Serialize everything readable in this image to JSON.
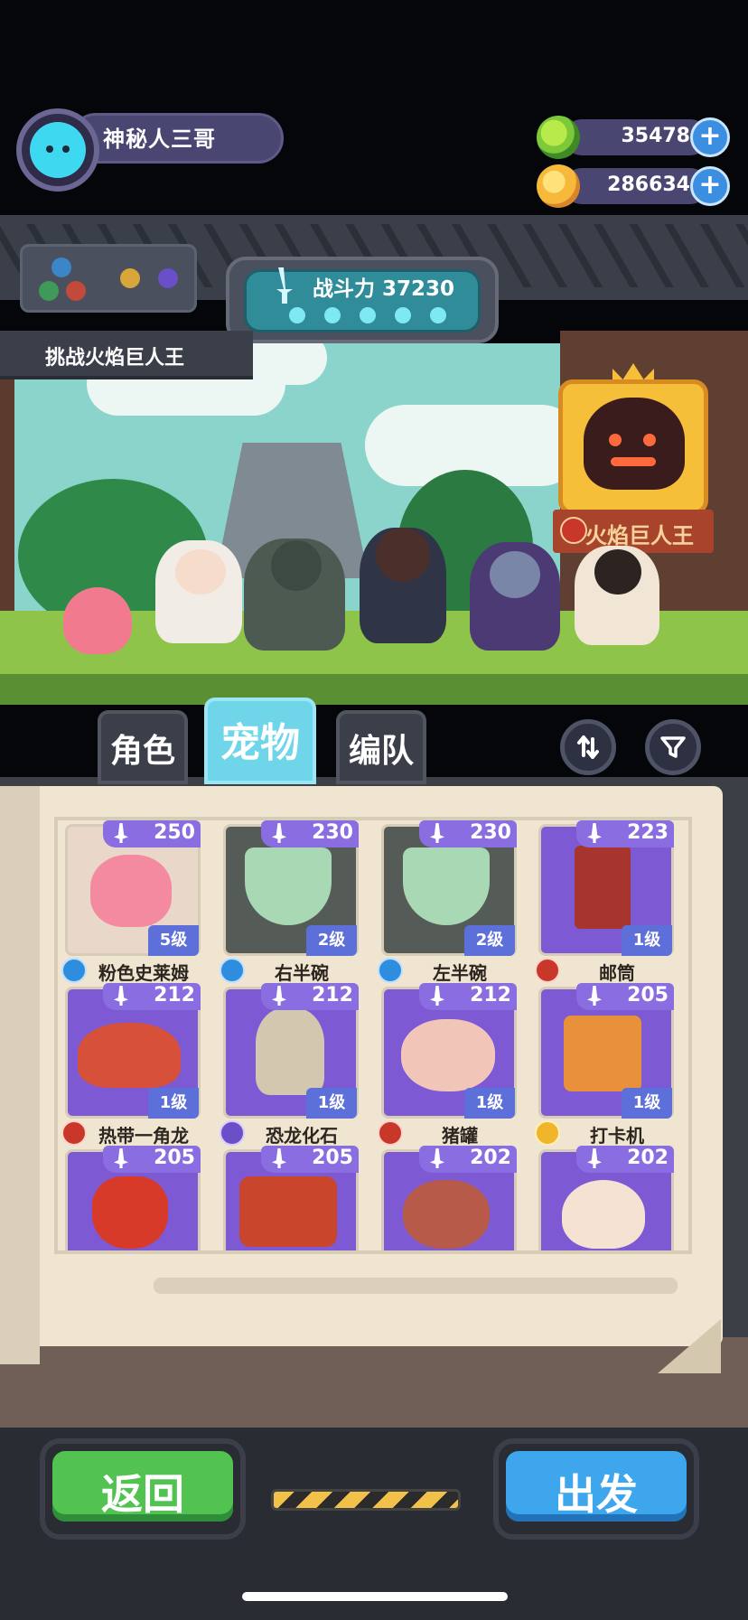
{
  "player": {
    "name": "神秘人三哥"
  },
  "currencies": [
    {
      "icon": "green-gem-coin-icon",
      "value": "35478"
    },
    {
      "icon": "gold-planet-coin-icon",
      "value": "286634"
    }
  ],
  "battle_power": {
    "label": "战斗力 37230",
    "dots": 5
  },
  "challenge": {
    "label": "挑战火焰巨人王"
  },
  "boss": {
    "name": "火焰巨人王",
    "element": "fire"
  },
  "tabs": [
    {
      "label": "角色",
      "active": false
    },
    {
      "label": "宠物",
      "active": true
    },
    {
      "label": "编队",
      "active": false
    }
  ],
  "toolbar": {
    "sort_icon": "sort-arrows-icon",
    "filter_icon": "filter-funnel-icon"
  },
  "pets": [
    {
      "name": "粉色史莱姆",
      "power": "250",
      "level": "5级",
      "element": "water",
      "frame": "pink",
      "art": "pink-slime"
    },
    {
      "name": "右半碗",
      "power": "230",
      "level": "2级",
      "element": "water",
      "frame": "green",
      "art": "half-bowl"
    },
    {
      "name": "左半碗",
      "power": "230",
      "level": "2级",
      "element": "water",
      "frame": "green",
      "art": "half-bowl"
    },
    {
      "name": "邮筒",
      "power": "223",
      "level": "1级",
      "element": "fire",
      "frame": "purple",
      "art": "mailbox"
    },
    {
      "name": "热带一角龙",
      "power": "212",
      "level": "1级",
      "element": "fire",
      "frame": "purple",
      "art": "lizard"
    },
    {
      "name": "恐龙化石",
      "power": "212",
      "level": "1级",
      "element": "dark",
      "frame": "purple",
      "art": "fossil"
    },
    {
      "name": "猪罐",
      "power": "212",
      "level": "1级",
      "element": "fire",
      "frame": "purple",
      "art": "piggy"
    },
    {
      "name": "打卡机",
      "power": "205",
      "level": "1级",
      "element": "light",
      "frame": "purple",
      "art": "clock-machine"
    },
    {
      "name": "",
      "power": "205",
      "level": "",
      "element": "",
      "frame": "purple",
      "art": "red-pot"
    },
    {
      "name": "",
      "power": "205",
      "level": "",
      "element": "",
      "frame": "purple",
      "art": "drum"
    },
    {
      "name": "",
      "power": "202",
      "level": "",
      "element": "",
      "frame": "purple",
      "art": "ham"
    },
    {
      "name": "",
      "power": "202",
      "level": "",
      "element": "",
      "frame": "purple",
      "art": "dumpling"
    }
  ],
  "buttons": {
    "back": "返回",
    "go": "出发"
  },
  "colors": {
    "purple_frame": "#7d5ad4",
    "accent_blue": "#3ea6ec",
    "accent_green": "#52c251",
    "active_tab": "#6fd6ea"
  }
}
